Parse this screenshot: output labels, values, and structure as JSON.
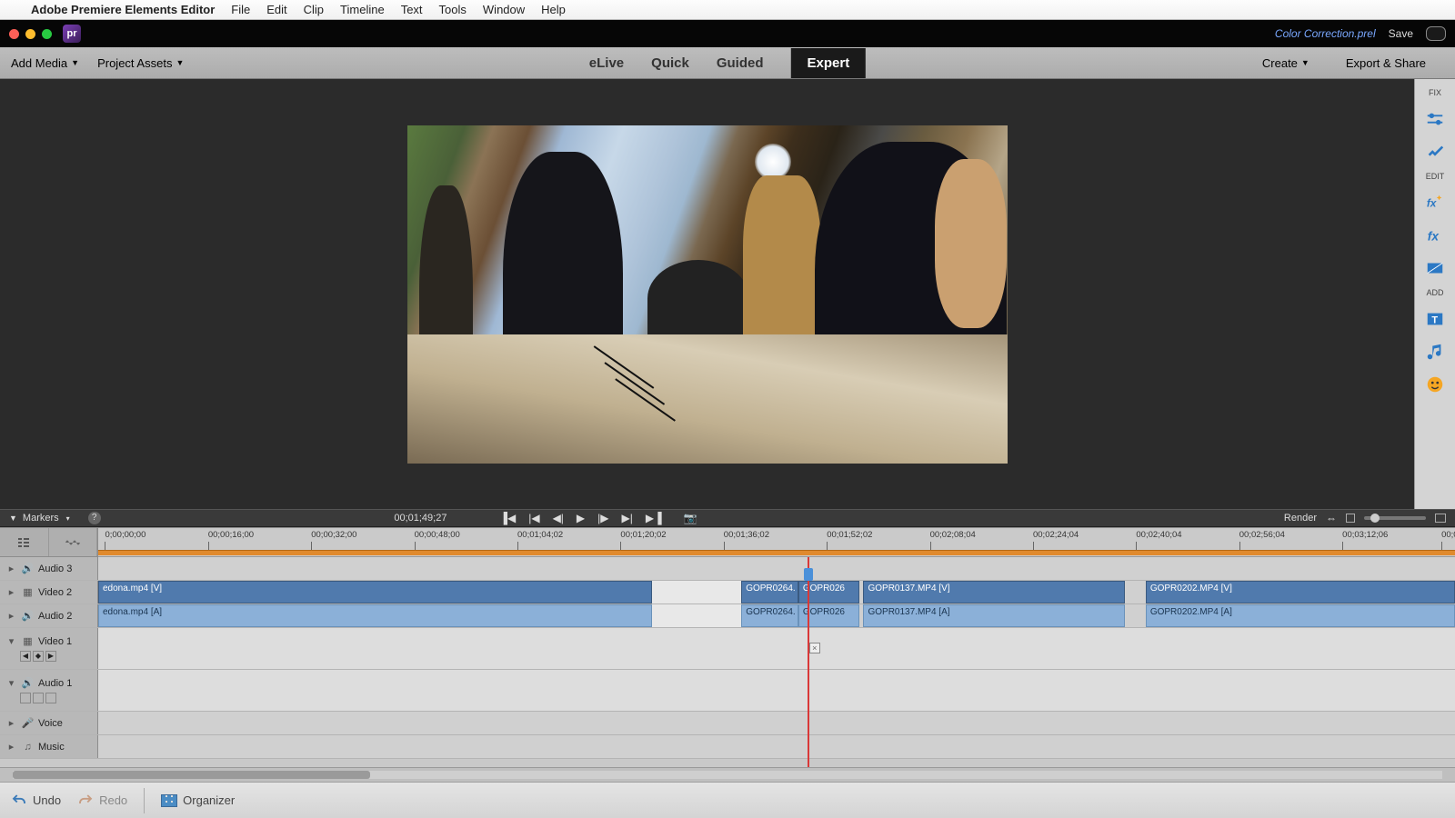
{
  "mac_menu": {
    "app": "Adobe Premiere Elements Editor",
    "items": [
      "File",
      "Edit",
      "Clip",
      "Timeline",
      "Text",
      "Tools",
      "Window",
      "Help"
    ]
  },
  "title": {
    "project": "Color Correction.prel",
    "save": "Save"
  },
  "sec": {
    "add_media": "Add Media",
    "project_assets": "Project Assets",
    "modes": [
      "eLive",
      "Quick",
      "Guided",
      "Expert"
    ],
    "active_mode": "Expert",
    "create": "Create",
    "export": "Export & Share"
  },
  "rpanel": {
    "fix": "FIX",
    "edit": "EDIT",
    "add": "ADD"
  },
  "play": {
    "markers": "Markers",
    "timecode": "00;01;49;27",
    "render": "Render"
  },
  "ruler": [
    "0;00;00;00",
    "00;00;16;00",
    "00;00;32;00",
    "00;00;48;00",
    "00;01;04;02",
    "00;01;20;02",
    "00;01;36;02",
    "00;01;52;02",
    "00;02;08;04",
    "00;02;24;04",
    "00;02;40;04",
    "00;02;56;04",
    "00;03;12;06",
    "00;0"
  ],
  "tracks": {
    "audio3": "Audio 3",
    "video2": "Video 2",
    "audio2": "Audio 2",
    "video1": "Video 1",
    "audio1": "Audio 1",
    "voice": "Voice",
    "music": "Music"
  },
  "clips": {
    "c1v": "edona.mp4 [V]",
    "c1a": "edona.mp4 [A]",
    "c2": "GOPR0264.",
    "c3": "GOPR026",
    "c4v": "GOPR0137.MP4 [V]",
    "c4a": "GOPR0137.MP4 [A]",
    "c5v": "GOPR0202.MP4 [V]",
    "c5a": "GOPR0202.MP4 [A]"
  },
  "footer": {
    "undo": "Undo",
    "redo": "Redo",
    "organizer": "Organizer"
  }
}
